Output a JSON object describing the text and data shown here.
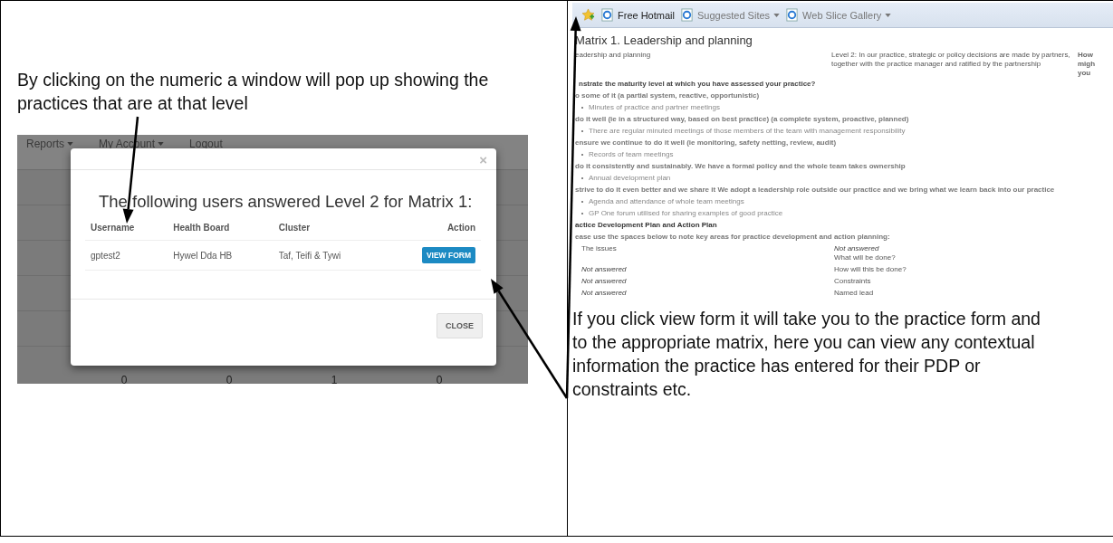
{
  "left_cell": {
    "caption": "By clicking on the numeric a window will pop up showing the practices that are at that level",
    "screenshot": {
      "nav": [
        {
          "label": "Reports",
          "dropdown": true
        },
        {
          "label": "My Account",
          "dropdown": true
        },
        {
          "label": "Logout",
          "dropdown": false
        }
      ],
      "background_numbers": [
        "0",
        "0",
        "1",
        "0"
      ],
      "modal": {
        "close": "×",
        "heading": "The following users answered Level 2 for Matrix 1:",
        "columns": [
          "Username",
          "Health Board",
          "Cluster",
          "Action"
        ],
        "rows": [
          {
            "username": "gptest2",
            "health_board": "Hywel Dda HB",
            "cluster": "Taf, Teifi & Tywi",
            "action": "VIEW FORM"
          }
        ],
        "footer_button": "CLOSE"
      }
    }
  },
  "right_cell": {
    "screenshot": {
      "favorites_bar": [
        {
          "label": "Free Hotmail",
          "dropdown": false,
          "dimmed": false
        },
        {
          "label": "Suggested Sites",
          "dropdown": true,
          "dimmed": true
        },
        {
          "label": "Web Slice Gallery",
          "dropdown": true,
          "dimmed": true
        }
      ],
      "title": "Matrix 1. Leadership and planning",
      "intro": {
        "column_1": "eadership and planning",
        "column_2": "Level 2: In our practice, strategic or policy decisions are made by partners, together with the practice manager and ratified by the partnership",
        "column_3": [
          "How",
          "migh",
          "you"
        ]
      },
      "question": "nstrate the maturity level at which you have assessed your practice?",
      "levels": [
        {
          "kind": "level",
          "text": "o some of it (a partial system, reactive, opportunistic)"
        },
        {
          "kind": "evidence",
          "text": "Minutes of practice and partner meetings"
        },
        {
          "kind": "level",
          "text": "do it well (ie in a structured way, based on best practice) (a complete system, proactive, planned)"
        },
        {
          "kind": "evidence",
          "text": "There are regular minuted meetings of those members of the team with management responsibility"
        },
        {
          "kind": "level",
          "text": "ensure we continue to do it well (ie monitoring, safety netting, review, audit)"
        },
        {
          "kind": "evidence",
          "text": "Records of team meetings"
        },
        {
          "kind": "level",
          "text": "do it consistently and sustainably. We have a formal policy and the whole team takes ownership"
        },
        {
          "kind": "evidence",
          "text": "Annual development plan"
        },
        {
          "kind": "level",
          "text": "strive to do it even better and we share it We adopt a leadership role outside our practice and we bring what we learn back into our practice"
        },
        {
          "kind": "evidence",
          "text": "Agenda and attendance of whole team meetings"
        },
        {
          "kind": "evidence",
          "text": "GP One forum utilised for sharing examples of good practice"
        }
      ],
      "plan_heading": "actice Development Plan and Action Plan",
      "plan_instruction": "ease use the spaces below to note key areas for practice development and action planning:",
      "plan_rows": [
        {
          "left": [
            {
              "kind": "prompt",
              "text": "The issues"
            }
          ],
          "right": [
            {
              "kind": "answer",
              "text": "Not answered"
            },
            {
              "kind": "prompt",
              "text": "What will be done?"
            }
          ]
        },
        {
          "left": [
            {
              "kind": "answer",
              "text": "Not answered"
            }
          ],
          "right": [
            {
              "kind": "prompt",
              "text": "How will this be done?"
            }
          ]
        },
        {
          "left": [
            {
              "kind": "answer",
              "text": "Not answered"
            }
          ],
          "right": [
            {
              "kind": "prompt",
              "text": "Constraints"
            }
          ]
        },
        {
          "left": [
            {
              "kind": "answer",
              "text": "Not answered"
            }
          ],
          "right": [
            {
              "kind": "prompt",
              "text": "Named lead"
            }
          ]
        }
      ]
    },
    "caption": "If you click view form it will take you to the practice form and to the appropriate matrix, here you can view any contextual information the practice has entered for their PDP or constraints etc."
  }
}
